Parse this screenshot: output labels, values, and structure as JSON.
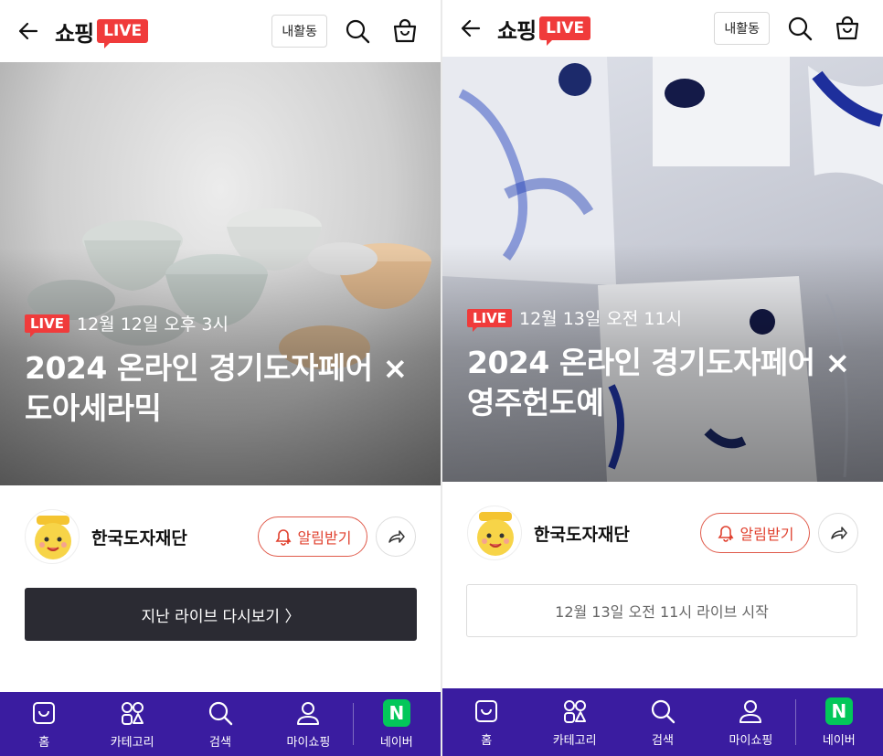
{
  "header": {
    "logo_text": "쇼핑",
    "logo_live": "LIVE",
    "my_area_label": "내활동"
  },
  "screens": [
    {
      "live_badge": "LIVE",
      "date": "12월 12일 오후 3시",
      "title_line1": "2024 온라인 경기도자페어 ×",
      "title_line2": "도아세라믹",
      "seller_name": "한국도자재단",
      "alarm_label": "알림받기",
      "action_label": "지난 라이브 다시보기 〉"
    },
    {
      "live_badge": "LIVE",
      "date": "12월 13일 오전 11시",
      "title_line1": "2024 온라인 경기도자페어 ×",
      "title_line2": "영주헌도예",
      "seller_name": "한국도자재단",
      "alarm_label": "알림받기",
      "action_label": "12월 13일 오전 11시 라이브 시작"
    }
  ],
  "bottom_nav": [
    {
      "label": "홈",
      "icon": "home-icon"
    },
    {
      "label": "카테고리",
      "icon": "category-icon"
    },
    {
      "label": "검색",
      "icon": "search-icon"
    },
    {
      "label": "마이쇼핑",
      "icon": "user-icon"
    },
    {
      "label": "네이버",
      "icon": "naver-icon",
      "glyph": "N"
    }
  ],
  "colors": {
    "live_red": "#f03b3b",
    "nav_purple": "#3a1ca0",
    "naver_green": "#03c75a",
    "alarm_red": "#e0402e",
    "dark_button": "#2b2b33"
  }
}
